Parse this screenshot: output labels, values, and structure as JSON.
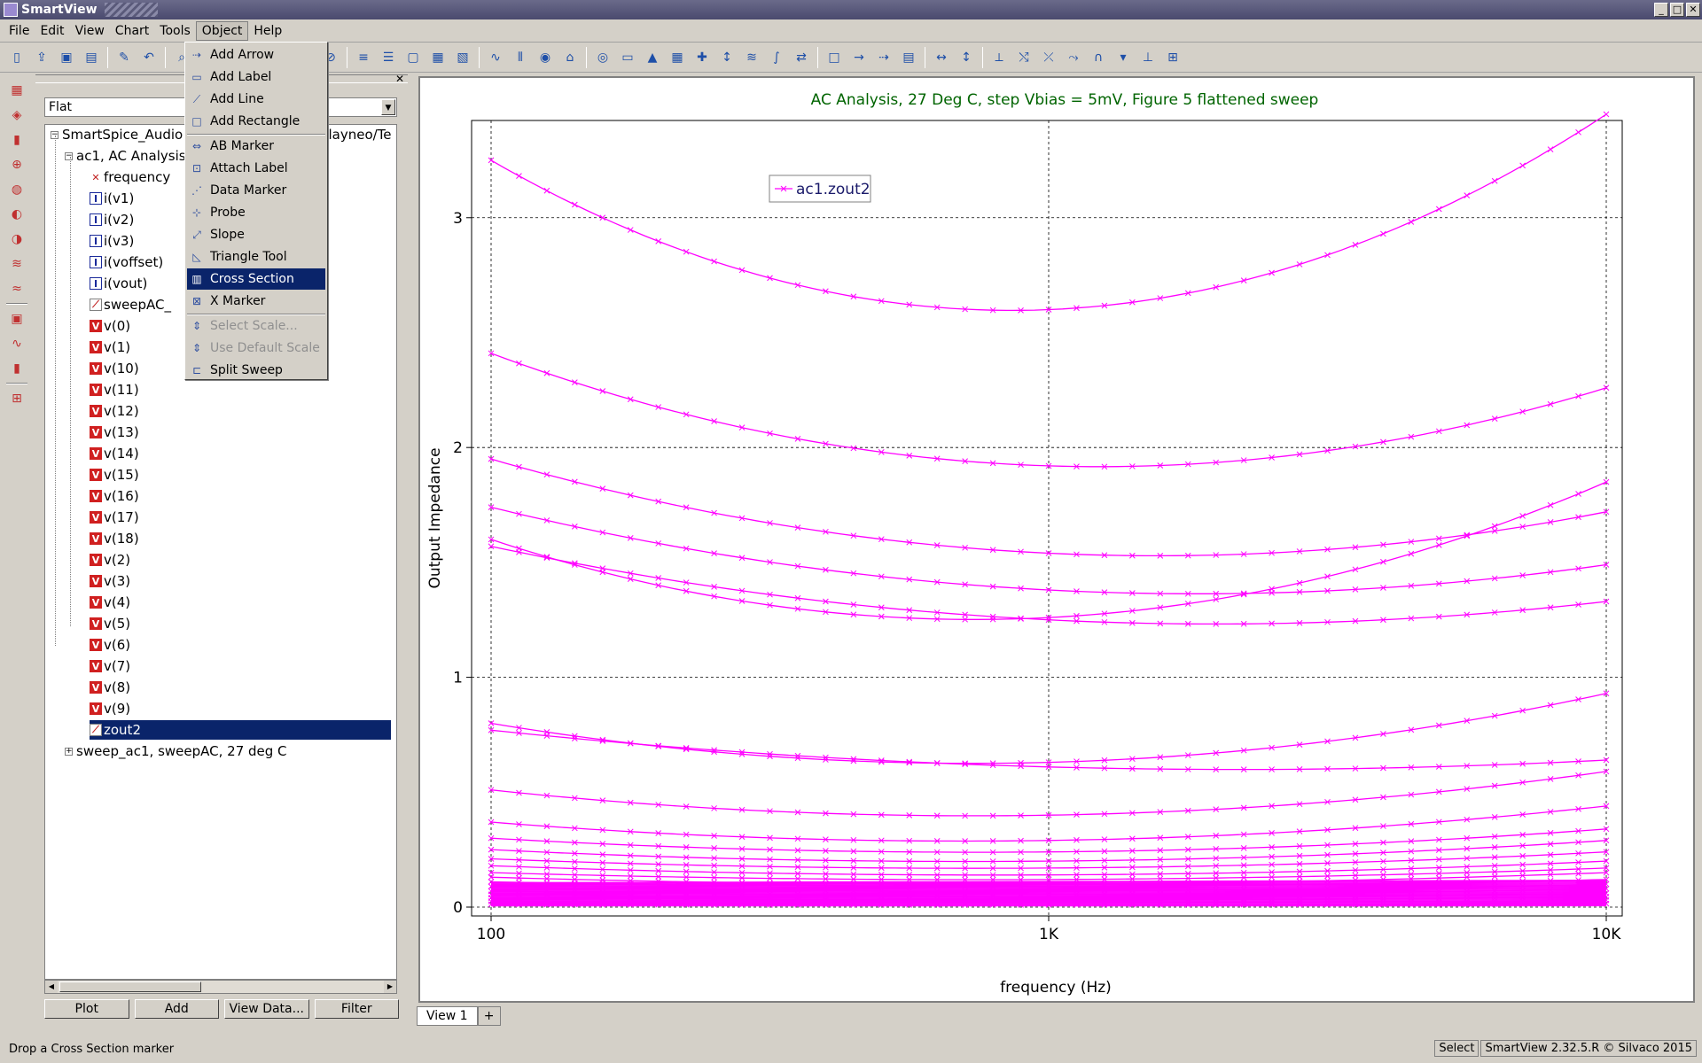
{
  "window": {
    "title": "SmartView"
  },
  "menubar": [
    "File",
    "Edit",
    "View",
    "Chart",
    "Tools",
    "Object",
    "Help"
  ],
  "object_menu": {
    "items": [
      {
        "label": "Add Arrow",
        "icon": "arrow-icon",
        "enabled": true
      },
      {
        "label": "Add Label",
        "icon": "label-icon",
        "enabled": true
      },
      {
        "label": "Add Line",
        "icon": "line-icon",
        "enabled": true
      },
      {
        "label": "Add Rectangle",
        "icon": "rectangle-icon",
        "enabled": true
      },
      {
        "label": "AB Marker",
        "icon": "ab-marker-icon",
        "enabled": true
      },
      {
        "label": "Attach Label",
        "icon": "attach-label-icon",
        "enabled": true
      },
      {
        "label": "Data Marker",
        "icon": "data-marker-icon",
        "enabled": true
      },
      {
        "label": "Probe",
        "icon": "probe-icon",
        "enabled": true
      },
      {
        "label": "Slope",
        "icon": "slope-icon",
        "enabled": true
      },
      {
        "label": "Triangle Tool",
        "icon": "triangle-icon",
        "enabled": true
      },
      {
        "label": "Cross Section",
        "icon": "cross-section-icon",
        "enabled": true,
        "highlighted": true
      },
      {
        "label": "X Marker",
        "icon": "x-marker-icon",
        "enabled": true
      },
      {
        "label": "Select Scale...",
        "icon": "select-scale-icon",
        "enabled": false
      },
      {
        "label": "Use Default Scale",
        "icon": "default-scale-icon",
        "enabled": false
      },
      {
        "label": "Split Sweep",
        "icon": "split-sweep-icon",
        "enabled": true
      }
    ]
  },
  "browser": {
    "view_mode": "Flat",
    "tree": {
      "root": "SmartSpice_Audio",
      "root_path_suffix": "e/layneo/Te",
      "analysis": "ac1, AC Analysis",
      "vectors": [
        {
          "name": "frequency",
          "kind": "F"
        },
        {
          "name": "i(v1)",
          "kind": "I"
        },
        {
          "name": "i(v2)",
          "kind": "I"
        },
        {
          "name": "i(v3)",
          "kind": "I"
        },
        {
          "name": "i(voffset)",
          "kind": "I"
        },
        {
          "name": "i(vout)",
          "kind": "I"
        },
        {
          "name": "sweepAC_",
          "kind": "S"
        },
        {
          "name": "v(0)",
          "kind": "V"
        },
        {
          "name": "v(1)",
          "kind": "V"
        },
        {
          "name": "v(10)",
          "kind": "V"
        },
        {
          "name": "v(11)",
          "kind": "V"
        },
        {
          "name": "v(12)",
          "kind": "V"
        },
        {
          "name": "v(13)",
          "kind": "V"
        },
        {
          "name": "v(14)",
          "kind": "V"
        },
        {
          "name": "v(15)",
          "kind": "V"
        },
        {
          "name": "v(16)",
          "kind": "V"
        },
        {
          "name": "v(17)",
          "kind": "V"
        },
        {
          "name": "v(18)",
          "kind": "V"
        },
        {
          "name": "v(2)",
          "kind": "V"
        },
        {
          "name": "v(3)",
          "kind": "V"
        },
        {
          "name": "v(4)",
          "kind": "V"
        },
        {
          "name": "v(5)",
          "kind": "V"
        },
        {
          "name": "v(6)",
          "kind": "V"
        },
        {
          "name": "v(7)",
          "kind": "V"
        },
        {
          "name": "v(8)",
          "kind": "V"
        },
        {
          "name": "v(9)",
          "kind": "V"
        },
        {
          "name": "zout2",
          "kind": "S",
          "selected": true
        }
      ],
      "sibling": "sweep_ac1, sweepAC, 27 deg C"
    },
    "buttons": [
      "Plot",
      "Add",
      "View Data...",
      "Filter"
    ]
  },
  "tabs": [
    "View 1",
    "+"
  ],
  "status": {
    "message": "Drop a Cross Section marker",
    "mode": "Select",
    "version": "SmartView 2.32.5.R © Silvaco 2015"
  },
  "colors": {
    "series": "#ff00ff",
    "title": "#006400",
    "selection": "#0a246a"
  },
  "chart_data": {
    "type": "line",
    "title": "AC Analysis, 27 Deg C, step Vbias = 5mV, Figure 5 flattened sweep",
    "xlabel": "frequency (Hz)",
    "ylabel": "Output Impedance",
    "xscale": "log",
    "xlim": [
      100,
      10000
    ],
    "ylim": [
      0,
      3.4
    ],
    "xticks": [
      {
        "v": 100,
        "label": "100"
      },
      {
        "v": 1000,
        "label": "1K"
      },
      {
        "v": 10000,
        "label": "10K"
      }
    ],
    "yticks": [
      {
        "v": 0,
        "label": "0"
      },
      {
        "v": 1,
        "label": "1"
      },
      {
        "v": 2,
        "label": "2"
      },
      {
        "v": 3,
        "label": "3"
      }
    ],
    "grid": true,
    "legend": {
      "position": "top-left",
      "entries": [
        "ac1.zout2"
      ]
    },
    "marker": "x",
    "x": [
      100,
      1000,
      10000
    ],
    "series": [
      {
        "name": "ac1.zout2",
        "values": [
          3.25,
          2.6,
          3.45
        ]
      },
      {
        "values": [
          2.41,
          1.92,
          2.26
        ]
      },
      {
        "values": [
          1.95,
          1.54,
          1.72
        ]
      },
      {
        "values": [
          1.74,
          1.38,
          1.49
        ]
      },
      {
        "values": [
          1.6,
          1.26,
          1.85
        ]
      },
      {
        "values": [
          1.57,
          1.25,
          1.33
        ]
      },
      {
        "values": [
          0.8,
          0.63,
          0.93
        ]
      },
      {
        "values": [
          0.77,
          0.61,
          0.64
        ]
      },
      {
        "values": [
          0.51,
          0.4,
          0.59
        ]
      },
      {
        "values": [
          0.37,
          0.29,
          0.44
        ]
      },
      {
        "values": [
          0.3,
          0.24,
          0.34
        ]
      },
      {
        "values": [
          0.25,
          0.2,
          0.29
        ]
      },
      {
        "values": [
          0.21,
          0.17,
          0.24
        ]
      },
      {
        "values": [
          0.18,
          0.14,
          0.2
        ]
      },
      {
        "values": [
          0.15,
          0.12,
          0.17
        ]
      },
      {
        "values": [
          0.13,
          0.1,
          0.15
        ]
      },
      {
        "values": [
          0.11,
          0.09,
          0.12
        ]
      },
      {
        "values": [
          0.09,
          0.07,
          0.1
        ]
      },
      {
        "values": [
          0.07,
          0.055,
          0.08
        ]
      },
      {
        "values": [
          0.055,
          0.045,
          0.06
        ]
      },
      {
        "values": [
          0.04,
          0.032,
          0.045
        ]
      },
      {
        "values": [
          0.025,
          0.02,
          0.03
        ]
      },
      {
        "values": [
          0.012,
          0.01,
          0.015
        ]
      }
    ]
  }
}
